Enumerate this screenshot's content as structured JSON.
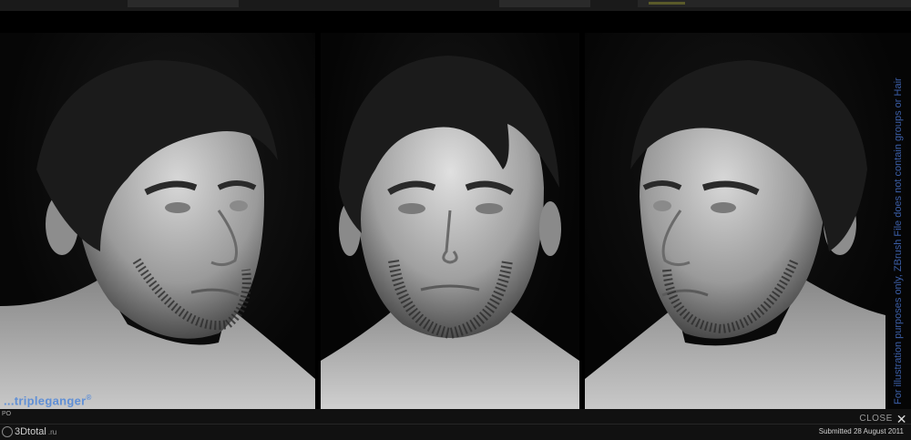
{
  "viewer": {
    "watermark_brand": "tripleganger",
    "watermark_brand_prefix": "...",
    "watermark_reg": "®",
    "side_note": "For illustration purposes only, ZBrush File does not contain groups or Hair",
    "close_label": "CLOSE",
    "close_icon": "close-icon",
    "submitted_label": "Submitted 28 August 2011",
    "corner_prefix": "PO",
    "site_logo_text": "3Dtotal",
    "site_logo_suffix": ".ru"
  },
  "colors": {
    "brand_blue": "#5f8fd6",
    "note_blue": "#3c5fa8",
    "background": "#000000",
    "bar": "#111111"
  },
  "views": [
    {
      "name": "three-quarter-left"
    },
    {
      "name": "front"
    },
    {
      "name": "three-quarter-right"
    }
  ]
}
